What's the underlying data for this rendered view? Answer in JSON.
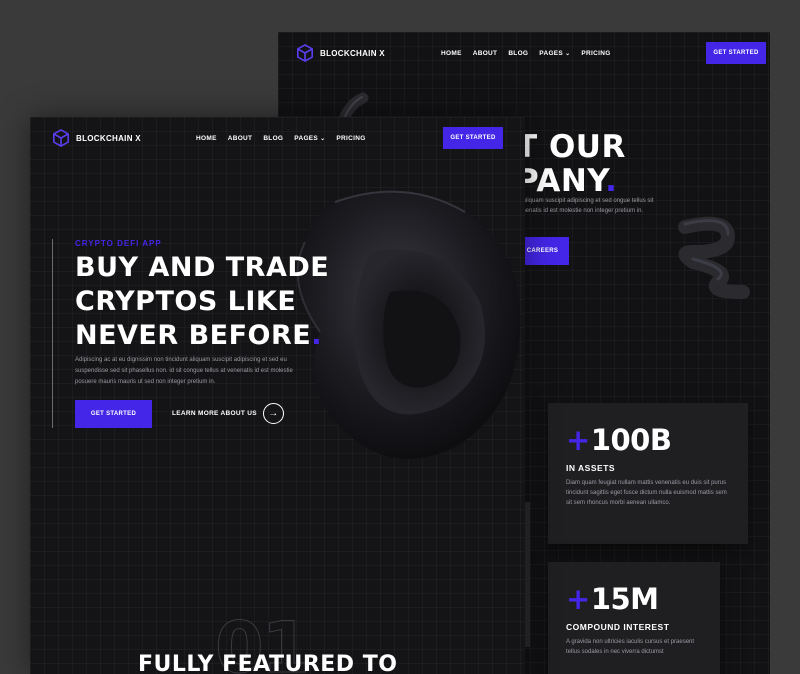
{
  "brand": {
    "name": "BLOCKCHAIN X",
    "accent": "#4426e8"
  },
  "back": {
    "nav": {
      "items": [
        "HOME",
        "ABOUT",
        "BLOG",
        "PAGES",
        "PRICING"
      ],
      "cta": "GET STARTED"
    },
    "headline_line1": "T OUR",
    "headline_line2": "PANY",
    "headline_dot": ".",
    "body": "nt aliquam suscipit adipiscing et sed ongue tellus sit venenatis id est molestie non integer pretium in.",
    "careers_label": "CAREERS",
    "stats": [
      {
        "plus": "+",
        "value": "100B",
        "label": "IN ASSETS",
        "desc": "Diam quam feugiat nullam mattis venenatis eu duis sit purus tincidunt sagittis eget fusce dictum nulla euismod mattis sem sit sem rhoncus morbi aenean ullamco."
      },
      {
        "plus": "+",
        "value": "15M",
        "label": "COMPOUND INTEREST",
        "desc": "A gravida non ultricies iaculis cursus et praesent tellus sodales in nec viverra dictumst"
      }
    ]
  },
  "front": {
    "nav": {
      "items": [
        "HOME",
        "ABOUT",
        "BLOG",
        "PAGES",
        "PRICING"
      ],
      "cta": "GET STARTED"
    },
    "eyebrow": "CRYPTO DEFI APP",
    "title_line1": "BUY AND TRADE",
    "title_line2": "CRYPTOS LIKE",
    "title_line3": "NEVER BEFORE",
    "title_dot": ".",
    "body": "Adipiscing ac at eu dignissim non tincidunt aliquam suscipit adipiscing et sed eu suspendisse sed sit phasellus non. id sit congue tellus at venenatis id est molestie posuere mauris mauris ut sed non integer pretium in.",
    "cta": "GET STARTED",
    "learn_more": "LEARN MORE ABOUT US",
    "big_number": "01",
    "section_title": "FULLY FEATURED TO"
  }
}
